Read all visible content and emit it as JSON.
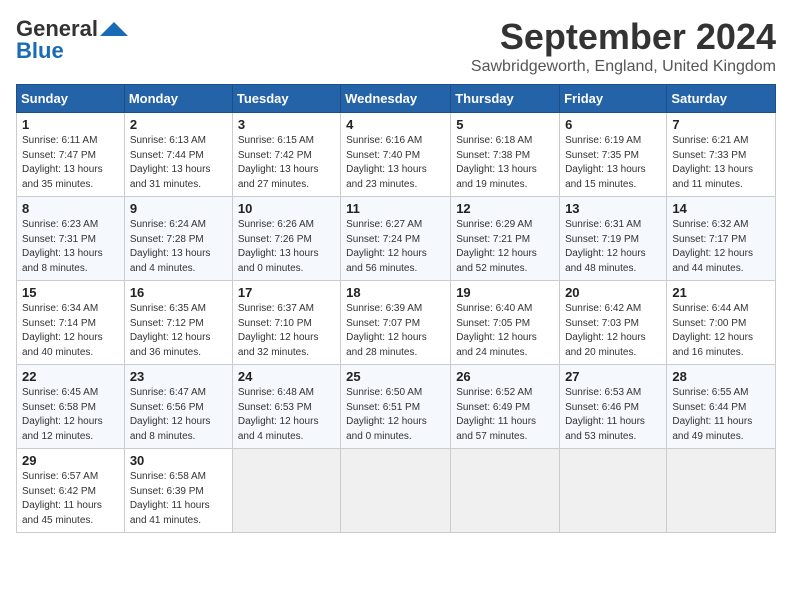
{
  "header": {
    "logo_line1": "General",
    "logo_line2": "Blue",
    "month_title": "September 2024",
    "location": "Sawbridgeworth, England, United Kingdom"
  },
  "weekdays": [
    "Sunday",
    "Monday",
    "Tuesday",
    "Wednesday",
    "Thursday",
    "Friday",
    "Saturday"
  ],
  "weeks": [
    [
      {
        "day": "1",
        "info": "Sunrise: 6:11 AM\nSunset: 7:47 PM\nDaylight: 13 hours\nand 35 minutes."
      },
      {
        "day": "2",
        "info": "Sunrise: 6:13 AM\nSunset: 7:44 PM\nDaylight: 13 hours\nand 31 minutes."
      },
      {
        "day": "3",
        "info": "Sunrise: 6:15 AM\nSunset: 7:42 PM\nDaylight: 13 hours\nand 27 minutes."
      },
      {
        "day": "4",
        "info": "Sunrise: 6:16 AM\nSunset: 7:40 PM\nDaylight: 13 hours\nand 23 minutes."
      },
      {
        "day": "5",
        "info": "Sunrise: 6:18 AM\nSunset: 7:38 PM\nDaylight: 13 hours\nand 19 minutes."
      },
      {
        "day": "6",
        "info": "Sunrise: 6:19 AM\nSunset: 7:35 PM\nDaylight: 13 hours\nand 15 minutes."
      },
      {
        "day": "7",
        "info": "Sunrise: 6:21 AM\nSunset: 7:33 PM\nDaylight: 13 hours\nand 11 minutes."
      }
    ],
    [
      {
        "day": "8",
        "info": "Sunrise: 6:23 AM\nSunset: 7:31 PM\nDaylight: 13 hours\nand 8 minutes."
      },
      {
        "day": "9",
        "info": "Sunrise: 6:24 AM\nSunset: 7:28 PM\nDaylight: 13 hours\nand 4 minutes."
      },
      {
        "day": "10",
        "info": "Sunrise: 6:26 AM\nSunset: 7:26 PM\nDaylight: 13 hours\nand 0 minutes."
      },
      {
        "day": "11",
        "info": "Sunrise: 6:27 AM\nSunset: 7:24 PM\nDaylight: 12 hours\nand 56 minutes."
      },
      {
        "day": "12",
        "info": "Sunrise: 6:29 AM\nSunset: 7:21 PM\nDaylight: 12 hours\nand 52 minutes."
      },
      {
        "day": "13",
        "info": "Sunrise: 6:31 AM\nSunset: 7:19 PM\nDaylight: 12 hours\nand 48 minutes."
      },
      {
        "day": "14",
        "info": "Sunrise: 6:32 AM\nSunset: 7:17 PM\nDaylight: 12 hours\nand 44 minutes."
      }
    ],
    [
      {
        "day": "15",
        "info": "Sunrise: 6:34 AM\nSunset: 7:14 PM\nDaylight: 12 hours\nand 40 minutes."
      },
      {
        "day": "16",
        "info": "Sunrise: 6:35 AM\nSunset: 7:12 PM\nDaylight: 12 hours\nand 36 minutes."
      },
      {
        "day": "17",
        "info": "Sunrise: 6:37 AM\nSunset: 7:10 PM\nDaylight: 12 hours\nand 32 minutes."
      },
      {
        "day": "18",
        "info": "Sunrise: 6:39 AM\nSunset: 7:07 PM\nDaylight: 12 hours\nand 28 minutes."
      },
      {
        "day": "19",
        "info": "Sunrise: 6:40 AM\nSunset: 7:05 PM\nDaylight: 12 hours\nand 24 minutes."
      },
      {
        "day": "20",
        "info": "Sunrise: 6:42 AM\nSunset: 7:03 PM\nDaylight: 12 hours\nand 20 minutes."
      },
      {
        "day": "21",
        "info": "Sunrise: 6:44 AM\nSunset: 7:00 PM\nDaylight: 12 hours\nand 16 minutes."
      }
    ],
    [
      {
        "day": "22",
        "info": "Sunrise: 6:45 AM\nSunset: 6:58 PM\nDaylight: 12 hours\nand 12 minutes."
      },
      {
        "day": "23",
        "info": "Sunrise: 6:47 AM\nSunset: 6:56 PM\nDaylight: 12 hours\nand 8 minutes."
      },
      {
        "day": "24",
        "info": "Sunrise: 6:48 AM\nSunset: 6:53 PM\nDaylight: 12 hours\nand 4 minutes."
      },
      {
        "day": "25",
        "info": "Sunrise: 6:50 AM\nSunset: 6:51 PM\nDaylight: 12 hours\nand 0 minutes."
      },
      {
        "day": "26",
        "info": "Sunrise: 6:52 AM\nSunset: 6:49 PM\nDaylight: 11 hours\nand 57 minutes."
      },
      {
        "day": "27",
        "info": "Sunrise: 6:53 AM\nSunset: 6:46 PM\nDaylight: 11 hours\nand 53 minutes."
      },
      {
        "day": "28",
        "info": "Sunrise: 6:55 AM\nSunset: 6:44 PM\nDaylight: 11 hours\nand 49 minutes."
      }
    ],
    [
      {
        "day": "29",
        "info": "Sunrise: 6:57 AM\nSunset: 6:42 PM\nDaylight: 11 hours\nand 45 minutes."
      },
      {
        "day": "30",
        "info": "Sunrise: 6:58 AM\nSunset: 6:39 PM\nDaylight: 11 hours\nand 41 minutes."
      },
      null,
      null,
      null,
      null,
      null
    ]
  ]
}
